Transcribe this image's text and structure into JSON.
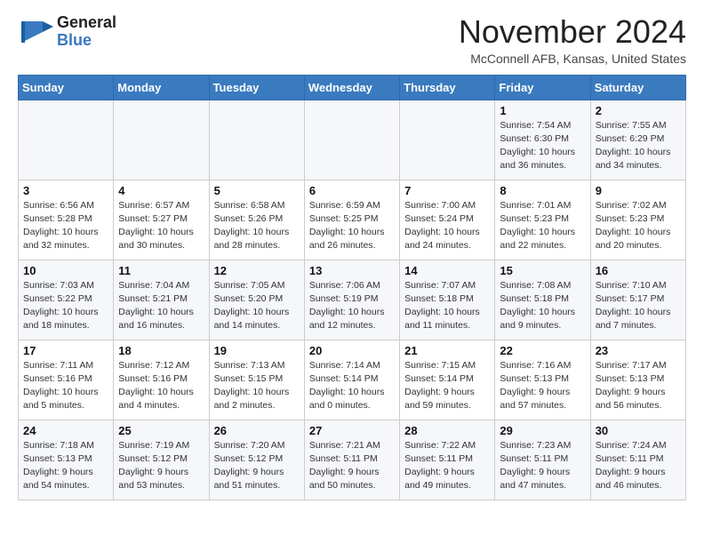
{
  "header": {
    "logo_general": "General",
    "logo_blue": "Blue",
    "month_title": "November 2024",
    "location": "McConnell AFB, Kansas, United States"
  },
  "weekdays": [
    "Sunday",
    "Monday",
    "Tuesday",
    "Wednesday",
    "Thursday",
    "Friday",
    "Saturday"
  ],
  "weeks": [
    [
      {
        "day": "",
        "info": ""
      },
      {
        "day": "",
        "info": ""
      },
      {
        "day": "",
        "info": ""
      },
      {
        "day": "",
        "info": ""
      },
      {
        "day": "",
        "info": ""
      },
      {
        "day": "1",
        "info": "Sunrise: 7:54 AM\nSunset: 6:30 PM\nDaylight: 10 hours\nand 36 minutes."
      },
      {
        "day": "2",
        "info": "Sunrise: 7:55 AM\nSunset: 6:29 PM\nDaylight: 10 hours\nand 34 minutes."
      }
    ],
    [
      {
        "day": "3",
        "info": "Sunrise: 6:56 AM\nSunset: 5:28 PM\nDaylight: 10 hours\nand 32 minutes."
      },
      {
        "day": "4",
        "info": "Sunrise: 6:57 AM\nSunset: 5:27 PM\nDaylight: 10 hours\nand 30 minutes."
      },
      {
        "day": "5",
        "info": "Sunrise: 6:58 AM\nSunset: 5:26 PM\nDaylight: 10 hours\nand 28 minutes."
      },
      {
        "day": "6",
        "info": "Sunrise: 6:59 AM\nSunset: 5:25 PM\nDaylight: 10 hours\nand 26 minutes."
      },
      {
        "day": "7",
        "info": "Sunrise: 7:00 AM\nSunset: 5:24 PM\nDaylight: 10 hours\nand 24 minutes."
      },
      {
        "day": "8",
        "info": "Sunrise: 7:01 AM\nSunset: 5:23 PM\nDaylight: 10 hours\nand 22 minutes."
      },
      {
        "day": "9",
        "info": "Sunrise: 7:02 AM\nSunset: 5:23 PM\nDaylight: 10 hours\nand 20 minutes."
      }
    ],
    [
      {
        "day": "10",
        "info": "Sunrise: 7:03 AM\nSunset: 5:22 PM\nDaylight: 10 hours\nand 18 minutes."
      },
      {
        "day": "11",
        "info": "Sunrise: 7:04 AM\nSunset: 5:21 PM\nDaylight: 10 hours\nand 16 minutes."
      },
      {
        "day": "12",
        "info": "Sunrise: 7:05 AM\nSunset: 5:20 PM\nDaylight: 10 hours\nand 14 minutes."
      },
      {
        "day": "13",
        "info": "Sunrise: 7:06 AM\nSunset: 5:19 PM\nDaylight: 10 hours\nand 12 minutes."
      },
      {
        "day": "14",
        "info": "Sunrise: 7:07 AM\nSunset: 5:18 PM\nDaylight: 10 hours\nand 11 minutes."
      },
      {
        "day": "15",
        "info": "Sunrise: 7:08 AM\nSunset: 5:18 PM\nDaylight: 10 hours\nand 9 minutes."
      },
      {
        "day": "16",
        "info": "Sunrise: 7:10 AM\nSunset: 5:17 PM\nDaylight: 10 hours\nand 7 minutes."
      }
    ],
    [
      {
        "day": "17",
        "info": "Sunrise: 7:11 AM\nSunset: 5:16 PM\nDaylight: 10 hours\nand 5 minutes."
      },
      {
        "day": "18",
        "info": "Sunrise: 7:12 AM\nSunset: 5:16 PM\nDaylight: 10 hours\nand 4 minutes."
      },
      {
        "day": "19",
        "info": "Sunrise: 7:13 AM\nSunset: 5:15 PM\nDaylight: 10 hours\nand 2 minutes."
      },
      {
        "day": "20",
        "info": "Sunrise: 7:14 AM\nSunset: 5:14 PM\nDaylight: 10 hours\nand 0 minutes."
      },
      {
        "day": "21",
        "info": "Sunrise: 7:15 AM\nSunset: 5:14 PM\nDaylight: 9 hours\nand 59 minutes."
      },
      {
        "day": "22",
        "info": "Sunrise: 7:16 AM\nSunset: 5:13 PM\nDaylight: 9 hours\nand 57 minutes."
      },
      {
        "day": "23",
        "info": "Sunrise: 7:17 AM\nSunset: 5:13 PM\nDaylight: 9 hours\nand 56 minutes."
      }
    ],
    [
      {
        "day": "24",
        "info": "Sunrise: 7:18 AM\nSunset: 5:13 PM\nDaylight: 9 hours\nand 54 minutes."
      },
      {
        "day": "25",
        "info": "Sunrise: 7:19 AM\nSunset: 5:12 PM\nDaylight: 9 hours\nand 53 minutes."
      },
      {
        "day": "26",
        "info": "Sunrise: 7:20 AM\nSunset: 5:12 PM\nDaylight: 9 hours\nand 51 minutes."
      },
      {
        "day": "27",
        "info": "Sunrise: 7:21 AM\nSunset: 5:11 PM\nDaylight: 9 hours\nand 50 minutes."
      },
      {
        "day": "28",
        "info": "Sunrise: 7:22 AM\nSunset: 5:11 PM\nDaylight: 9 hours\nand 49 minutes."
      },
      {
        "day": "29",
        "info": "Sunrise: 7:23 AM\nSunset: 5:11 PM\nDaylight: 9 hours\nand 47 minutes."
      },
      {
        "day": "30",
        "info": "Sunrise: 7:24 AM\nSunset: 5:11 PM\nDaylight: 9 hours\nand 46 minutes."
      }
    ]
  ]
}
